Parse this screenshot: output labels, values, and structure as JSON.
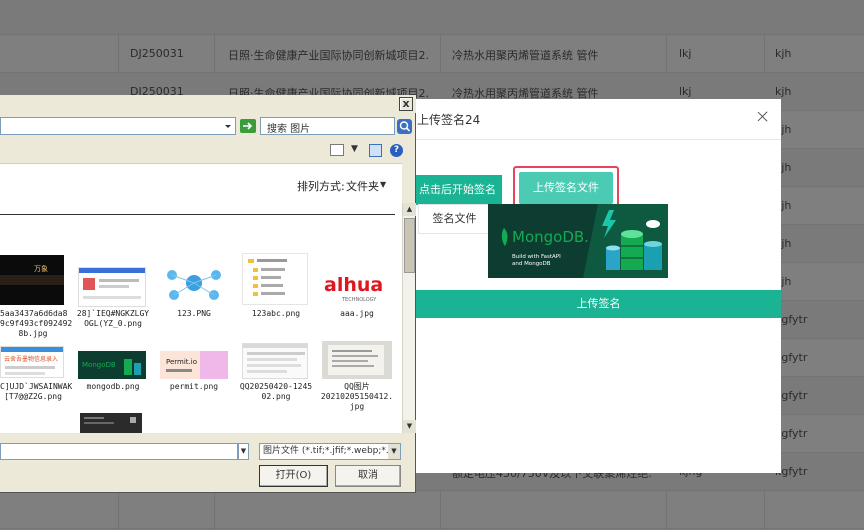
{
  "background_table": {
    "rows": [
      {
        "code": "",
        "project": "",
        "item": "",
        "c4": "",
        "c5": "",
        "alt": true
      },
      {
        "code": "DJ250031",
        "project": "日照·生命健康产业国际协同创新城项目2...",
        "item": "冷热水用聚丙烯管道系统 管件",
        "c4": "lkj",
        "c5": "kjh",
        "alt": false
      },
      {
        "code": "DJ250031",
        "project": "日照·生命健康产业国际协同创新城项目2...",
        "item": "冷热水用聚丙烯管道系统 管件",
        "c4": "lkj",
        "c5": "kjh",
        "alt": true
      },
      {
        "code": "",
        "project": "",
        "item": "",
        "c4": "",
        "c5": "kjh",
        "alt": false
      },
      {
        "code": "",
        "project": "",
        "item": "",
        "c4": "",
        "c5": "kjh",
        "alt": true
      },
      {
        "code": "",
        "project": "",
        "item": "",
        "c4": "",
        "c5": "kjh",
        "alt": false
      },
      {
        "code": "",
        "project": "",
        "item": "",
        "c4": "",
        "c5": "kjh",
        "alt": true
      },
      {
        "code": "",
        "project": "",
        "item": "",
        "c4": "",
        "c5": "kjh",
        "alt": false
      },
      {
        "code": "",
        "project": "",
        "item": "",
        "c4": "",
        "c5": "kgfytr",
        "alt": true
      },
      {
        "code": "",
        "project": "",
        "item": "",
        "c4": "",
        "c5": "kgfytr",
        "alt": false
      },
      {
        "code": "",
        "project": "",
        "item": "",
        "c4": "",
        "c5": "kgfytr",
        "alt": true
      },
      {
        "code": "",
        "project": "",
        "item": "",
        "c4": "",
        "c5": "kgfytr",
        "alt": false
      },
      {
        "code": "",
        "project": "",
        "item": "额定电压450/750V及以下交联聚烯烃绝...",
        "c4": "kjhg",
        "c5": "kgfytr",
        "alt": true
      },
      {
        "code": "",
        "project": "",
        "item": "",
        "c4": "",
        "c5": "",
        "alt": false
      }
    ]
  },
  "modal": {
    "title": "上传签名24",
    "tab_start": "点击后开始签名",
    "upload_file_button": "上传签名文件",
    "signature_label": "签名文件",
    "preview_logo_text": "MongoDB.",
    "preview_subtitle_1": "Build with FastAPI",
    "preview_subtitle_2": "and MongoDB",
    "upload_signature_button": "上传签名"
  },
  "file_dialog": {
    "close_glyph": "x",
    "search_placeholder": "搜索 图片",
    "help_glyph": "?",
    "sort_label": "排列方式:",
    "sort_value": "文件夹",
    "files": [
      {
        "caption_lines": [
          "5aa3437a6d6da8",
          "9c9f493cf092492",
          "8b.jpg"
        ]
      },
      {
        "caption_lines": [
          "28]`IEQ#NGKZLGY",
          "OGL(YZ_0.png"
        ]
      },
      {
        "caption_lines": [
          "123.PNG"
        ]
      },
      {
        "caption_lines": [
          "123abc.png"
        ]
      },
      {
        "caption_lines": [
          "aaa.jpg"
        ]
      },
      {
        "caption_lines": [
          "C]UJD`JWSAINWAK",
          "[T7@@Z2G.png"
        ]
      },
      {
        "caption_lines": [
          "mongodb.png"
        ]
      },
      {
        "caption_lines": [
          "permit.png"
        ]
      },
      {
        "caption_lines": [
          "QQ20250420-1245",
          "02.png"
        ]
      },
      {
        "caption_lines": [
          "QQ图片",
          "20210205150412.",
          "jpg"
        ]
      }
    ],
    "thumb_texts": {
      "dahua": "alhua",
      "dahua_sub": "TECHNOLOGY",
      "permit": "Permit.io",
      "mongodb_small": "MongoDB",
      "qr_title": "云舍吾墨物件表",
      "card_title": "云舍吾墨物信息录入"
    },
    "file_type_value": "图片文件 (*.tif;*.jfif;*.webp;*.pj",
    "open_button": "打开(O)",
    "cancel_button": "取消"
  }
}
